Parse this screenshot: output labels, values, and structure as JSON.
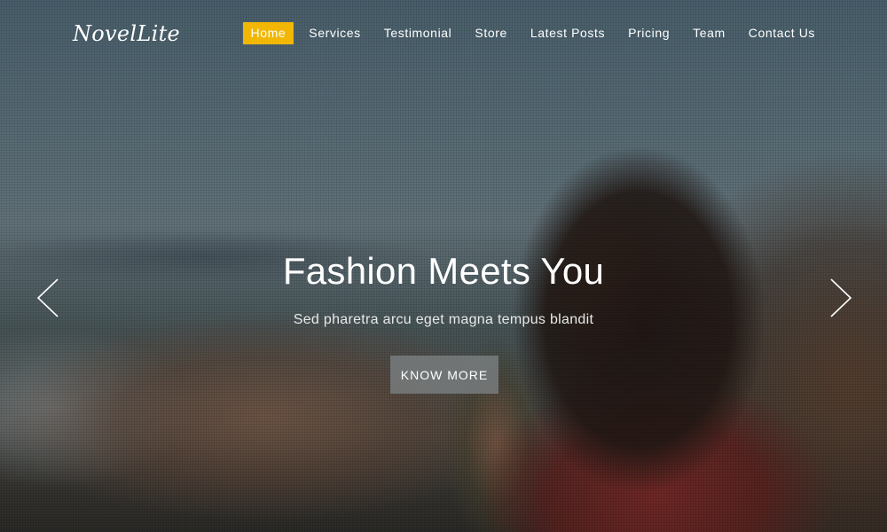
{
  "brand": {
    "logo_text": "NovelLite"
  },
  "nav": {
    "items": [
      {
        "label": "Home",
        "active": true
      },
      {
        "label": "Services",
        "active": false
      },
      {
        "label": "Testimonial",
        "active": false
      },
      {
        "label": "Store",
        "active": false
      },
      {
        "label": "Latest Posts",
        "active": false
      },
      {
        "label": "Pricing",
        "active": false
      },
      {
        "label": "Team",
        "active": false
      },
      {
        "label": "Contact Us",
        "active": false
      }
    ],
    "active_color": "#f2b705"
  },
  "hero": {
    "title": "Fashion Meets You",
    "subtitle": "Sed pharetra arcu eget magna tempus blandit",
    "button_label": "KNOW MORE",
    "prev_icon": "chevron-left-icon",
    "next_icon": "chevron-right-icon"
  }
}
